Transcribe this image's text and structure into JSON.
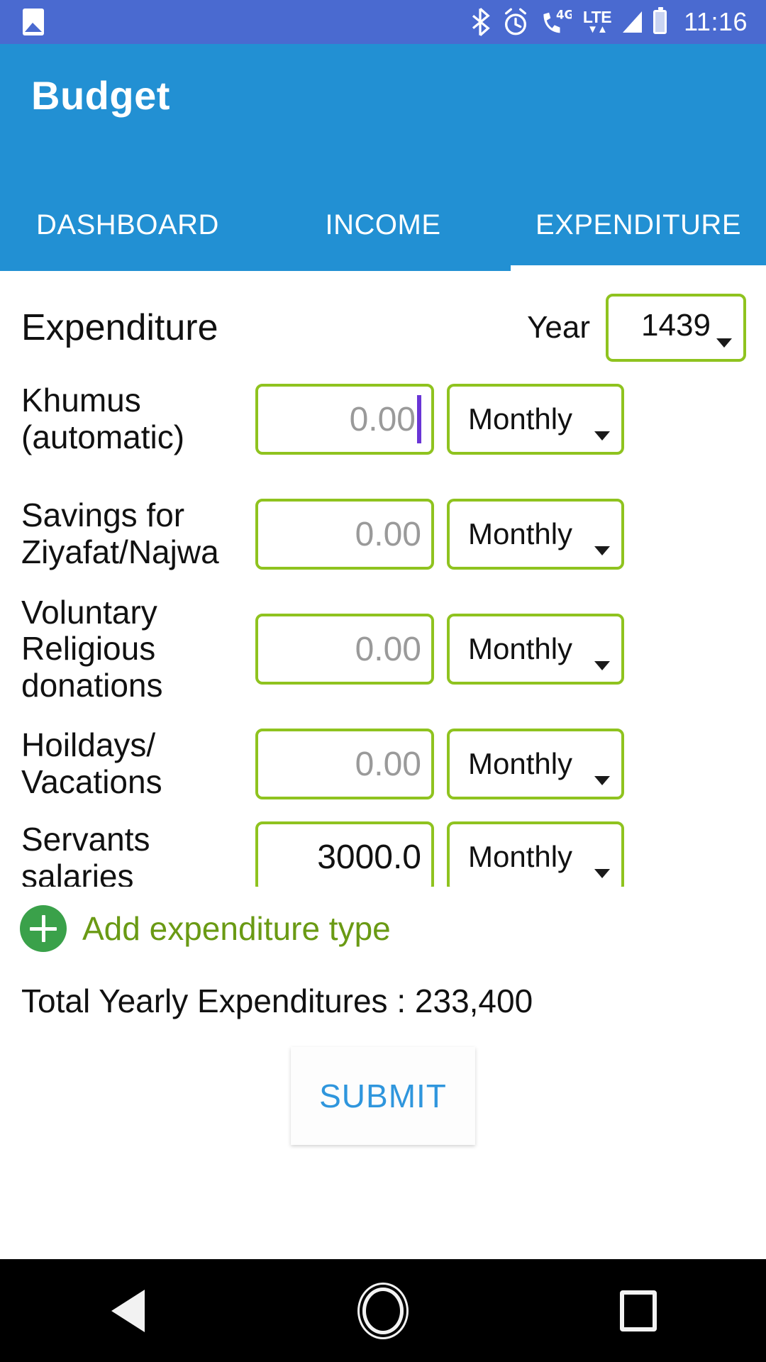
{
  "status_bar": {
    "time": "11:16",
    "icons": [
      "photo-icon",
      "bluetooth-icon",
      "alarm-icon",
      "call-4g-icon",
      "lte-icon",
      "signal-icon",
      "battery-icon"
    ],
    "lte_label": "LTE",
    "g4_label": "4G",
    "background": "#4a6ad0"
  },
  "appbar": {
    "title": "Budget",
    "background": "#2290d3",
    "tabs": [
      {
        "label": "DASHBOARD",
        "active": false
      },
      {
        "label": "INCOME",
        "active": false
      },
      {
        "label": "EXPENDITURE",
        "active": true
      }
    ]
  },
  "section": {
    "title": "Expenditure",
    "year_label": "Year",
    "year_value": "1439",
    "accent_green": "#8fc31f"
  },
  "rows": [
    {
      "label": "Khumus (automatic)",
      "amount": "0.00",
      "amount_filled": false,
      "has_cursor": true,
      "frequency": "Monthly"
    },
    {
      "label": "Savings for Ziyafat/Najwa",
      "amount": "0.00",
      "amount_filled": false,
      "has_cursor": false,
      "frequency": "Monthly"
    },
    {
      "label": "Voluntary Religious donations",
      "amount": "0.00",
      "amount_filled": false,
      "has_cursor": false,
      "frequency": "Monthly"
    },
    {
      "label": "Hoildays/ Vacations",
      "amount": "0.00",
      "amount_filled": false,
      "has_cursor": false,
      "frequency": "Monthly"
    },
    {
      "label": "Servants salaries",
      "amount": "3000.0",
      "amount_filled": true,
      "has_cursor": false,
      "frequency": "Monthly"
    }
  ],
  "add_row": {
    "icon": "plus-circle-icon",
    "label": "Add expenditure type",
    "label_color": "#6a9a14",
    "circle_color": "#3aa14a"
  },
  "total": {
    "text": "Total Yearly Expenditures : 233,400"
  },
  "submit": {
    "label": "SUBMIT",
    "color": "#2f96dd"
  },
  "navbar": {
    "buttons": [
      "back-icon",
      "home-icon",
      "recents-icon"
    ],
    "background": "#000000"
  }
}
